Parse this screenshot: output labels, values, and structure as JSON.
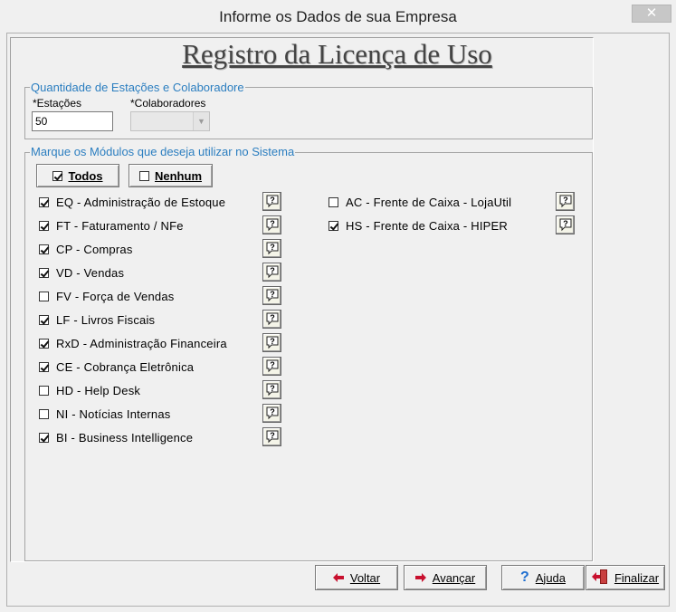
{
  "window": {
    "title": "Informe os Dados de sua Empresa",
    "close_glyph": "✕"
  },
  "header": {
    "title": "Registro da Licença de Uso"
  },
  "quantidade": {
    "group_label": "Quantidade de Estações e Colaboradore",
    "estacoes_label": "*Estações",
    "estacoes_value": "50",
    "colaboradores_label": "*Colaboradores",
    "colaboradores_value": ""
  },
  "modulos": {
    "group_label": "Marque os Módulos que deseja utilizar no Sistema",
    "todos_label": "Todos",
    "nenhum_label": "Nenhum",
    "items": [
      {
        "label": "EQ - Administração de Estoque",
        "checked": true
      },
      {
        "label": "FT - Faturamento / NFe",
        "checked": true
      },
      {
        "label": "CP - Compras",
        "checked": true
      },
      {
        "label": "VD - Vendas",
        "checked": true
      },
      {
        "label": "FV - Força de Vendas",
        "checked": false
      },
      {
        "label": "LF - Livros Fiscais",
        "checked": true
      },
      {
        "label": "RxD - Administração Financeira",
        "checked": true
      },
      {
        "label": "CE - Cobrança Eletrônica",
        "checked": true
      },
      {
        "label": "HD - Help Desk",
        "checked": false
      },
      {
        "label": "NI - Notícias Internas",
        "checked": false
      },
      {
        "label": "BI - Business Intelligence",
        "checked": true
      },
      {
        "label": "AC - Frente de Caixa - LojaUtil",
        "checked": false
      },
      {
        "label": "HS - Frente de Caixa - HIPER",
        "checked": true
      }
    ]
  },
  "footer": {
    "voltar": "Voltar",
    "avancar": "Avançar",
    "ajuda": "Ajuda",
    "finalizar": "Finalizar"
  },
  "colors": {
    "group_label": "#2b7ec0",
    "arrow_red": "#c8102e",
    "help_blue": "#1f6fd0"
  }
}
